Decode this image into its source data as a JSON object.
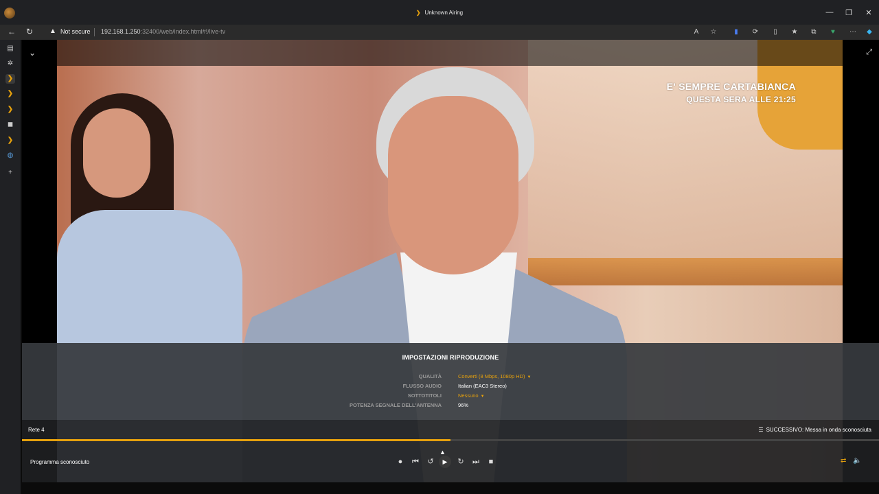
{
  "window": {
    "title": "Unknown Airing",
    "controls": [
      "minimize-icon",
      "restore-icon",
      "close-icon"
    ]
  },
  "addressbar": {
    "security_label": "Not secure",
    "url_host": "192.168.1.250",
    "url_rest": ":32400/web/index.html#!/live-tv"
  },
  "video": {
    "overlay_line1": "E' SEMPRE CARTABIANCA",
    "overlay_line2": "QUESTA SERA ALLE 21:25"
  },
  "settings": {
    "heading": "IMPOSTAZIONI RIPRODUZIONE",
    "rows": [
      {
        "label": "QUALITÀ",
        "value": "Converti (8 Mbps, 1080p HD)",
        "dropdown": true
      },
      {
        "label": "FLUSSO AUDIO",
        "value": "Italian (EAC3 Stereo)",
        "dropdown": false
      },
      {
        "label": "SOTTOTITOLI",
        "value": "Nessuno",
        "dropdown": true
      },
      {
        "label": "POTENZA SEGNALE DELL'ANTENNA",
        "value": "96%",
        "dropdown": false
      }
    ]
  },
  "player": {
    "channel": "Rete 4",
    "next_label": "SUCCESSIVO:",
    "next_value": "Messa in onda sconosciuta",
    "program": "Programma sconosciuto",
    "progress_fraction": 0.5
  },
  "colors": {
    "accent": "#e5a00d"
  }
}
